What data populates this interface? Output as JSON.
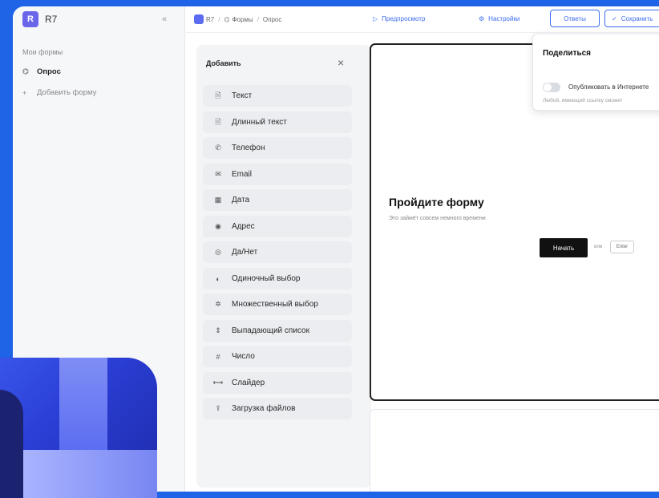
{
  "app": {
    "logo_letter": "R",
    "name": "R7"
  },
  "sidebar": {
    "collapse_icon": "chevrons-left-icon",
    "section_label": "Мои формы",
    "items": [
      {
        "label": "Опрос",
        "icon": "form-icon",
        "active": true
      },
      {
        "label": "Добавить форму",
        "icon": "plus-icon",
        "active": false
      }
    ]
  },
  "header": {
    "breadcrumbs": [
      "R7",
      "Формы",
      "Опрос"
    ],
    "preview_label": "Предпросмотр",
    "settings_label": "Настройки",
    "answers_label": "Ответы",
    "save_label": "Сохранить"
  },
  "add_panel": {
    "title": "Добавить",
    "items": [
      {
        "label": "Текст",
        "icon": "text-icon"
      },
      {
        "label": "Длинный текст",
        "icon": "long-text-icon"
      },
      {
        "label": "Телефон",
        "icon": "phone-icon"
      },
      {
        "label": "Email",
        "icon": "email-icon"
      },
      {
        "label": "Дата",
        "icon": "calendar-icon"
      },
      {
        "label": "Адрес",
        "icon": "location-icon"
      },
      {
        "label": "Да/Нет",
        "icon": "yes-no-icon"
      },
      {
        "label": "Одиночный выбор",
        "icon": "single-choice-icon"
      },
      {
        "label": "Множественный выбор",
        "icon": "multiple-choice-icon"
      },
      {
        "label": "Выпадающий список",
        "icon": "dropdown-icon"
      },
      {
        "label": "Число",
        "icon": "number-icon"
      },
      {
        "label": "Слайдер",
        "icon": "slider-icon"
      },
      {
        "label": "Загрузка файлов",
        "icon": "upload-icon"
      }
    ]
  },
  "form_preview": {
    "title": "Пройдите форму",
    "subtitle": "Это займёт совсем немного времени",
    "start_label": "Начать",
    "or_label": "или",
    "enter_label": "Enter"
  },
  "share_popover": {
    "title": "Поделиться",
    "toggle_label": "Опубликовать в Интернете",
    "hint": "Любой, имеющий ссылку сможет"
  },
  "colors": {
    "accent": "#3b6cf0",
    "background": "#1f63e6",
    "brand": "#6a66ea"
  }
}
